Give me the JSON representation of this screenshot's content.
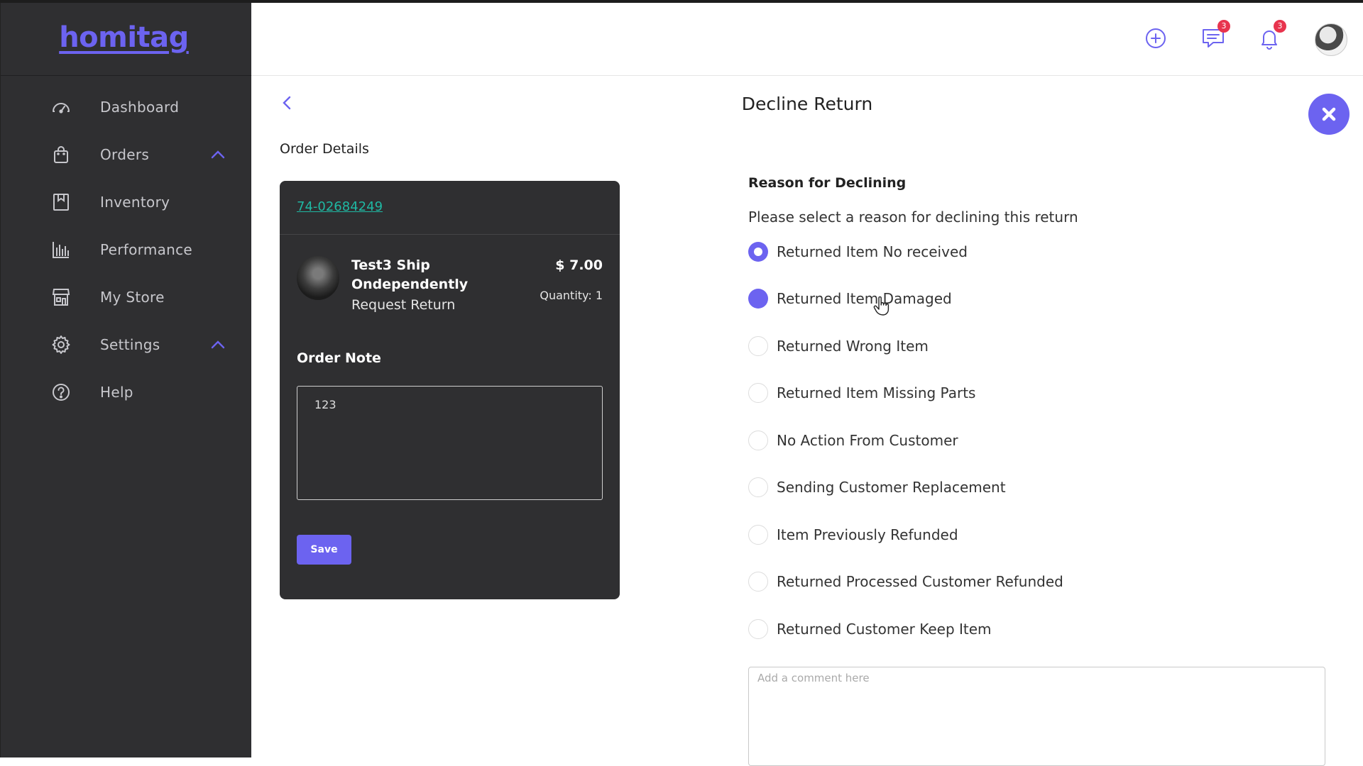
{
  "brand": {
    "logo": "homitag",
    "accent": "#6c63f0"
  },
  "sidebar": {
    "items": [
      {
        "label": "Dashboard",
        "icon": "dashboard-gauge-icon"
      },
      {
        "label": "Orders",
        "icon": "shopping-bag-icon",
        "expandable": true
      },
      {
        "label": "Inventory",
        "icon": "inventory-box-icon"
      },
      {
        "label": "Performance",
        "icon": "bar-chart-icon"
      },
      {
        "label": "My Store",
        "icon": "store-icon"
      },
      {
        "label": "Settings",
        "icon": "gear-icon",
        "expandable": true
      },
      {
        "label": "Help",
        "icon": "help-circle-icon"
      }
    ]
  },
  "header": {
    "messages_badge": "3",
    "notifications_badge": "3"
  },
  "page": {
    "title": "Decline Return",
    "order_details_label": "Order Details"
  },
  "order": {
    "id": "74-02684249",
    "product_name": "Test3 Ship Ondependently",
    "status": "Request Return",
    "price": "$ 7.00",
    "quantity": "Quantity: 1",
    "note_label": "Order Note",
    "note_value": "123",
    "save_label": "Save"
  },
  "decline": {
    "title": "Reason for Declining",
    "subtitle": "Please select a reason for declining this return",
    "options": [
      {
        "label": "Returned Item No received",
        "state": "checked"
      },
      {
        "label": "Returned Item Damaged",
        "state": "hover"
      },
      {
        "label": "Returned Wrong Item",
        "state": "unchecked"
      },
      {
        "label": "Returned Item Missing Parts",
        "state": "unchecked"
      },
      {
        "label": "No Action From Customer",
        "state": "unchecked"
      },
      {
        "label": "Sending Customer Replacement",
        "state": "unchecked"
      },
      {
        "label": "Item Previously Refunded",
        "state": "unchecked"
      },
      {
        "label": "Returned Processed Customer Refunded",
        "state": "unchecked"
      },
      {
        "label": "Returned Customer Keep Item",
        "state": "unchecked"
      }
    ],
    "comment_placeholder": "Add a comment here"
  }
}
